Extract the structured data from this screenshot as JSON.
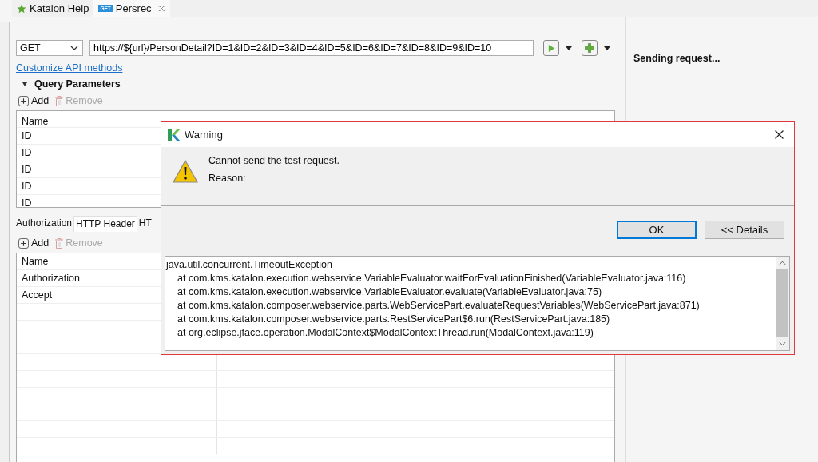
{
  "tabs": [
    {
      "kind": "help",
      "label": "Katalon Help",
      "selected": false
    },
    {
      "kind": "request",
      "label": "Persrec",
      "badge": "GET",
      "selected": true
    }
  ],
  "request": {
    "method": "GET",
    "url": "https://${url}/PersonDetail?ID=1&ID=2&ID=3&ID=4&ID=5&ID=6&ID=7&ID=8&ID=9&ID=10"
  },
  "customize_link": "Customize API methods",
  "query_section": {
    "title": "Query Parameters",
    "expanded": true,
    "add": "Add",
    "remove": "Remove",
    "remove_disabled": true,
    "column": "Name",
    "rows": [
      "ID",
      "ID",
      "ID",
      "ID",
      "ID"
    ]
  },
  "sub_tabs": [
    {
      "label": "Authorization",
      "selected": false
    },
    {
      "label": "HTTP Header",
      "selected": true
    },
    {
      "label": "HT",
      "selected": false
    }
  ],
  "headers_section": {
    "add": "Add",
    "remove": "Remove",
    "remove_disabled": true,
    "column": "Name",
    "rows": [
      "Authorization",
      "Accept"
    ]
  },
  "response": {
    "status": "Sending request..."
  },
  "dialog": {
    "title": "Warning",
    "message": "Cannot send the test request.",
    "reason_label": "Reason:",
    "buttons": [
      {
        "label": "OK",
        "default": true
      },
      {
        "label": "<< Details",
        "default": false
      }
    ],
    "details": [
      {
        "kind": "exception",
        "text": "java.util.concurrent.TimeoutException"
      },
      {
        "kind": "frame",
        "text": "at com.kms.katalon.execution.webservice.VariableEvaluator.waitForEvaluationFinished(VariableEvaluator.java:116)"
      },
      {
        "kind": "frame",
        "text": "at com.kms.katalon.execution.webservice.VariableEvaluator.evaluate(VariableEvaluator.java:75)"
      },
      {
        "kind": "frame",
        "text": "at com.kms.katalon.composer.webservice.parts.WebServicePart.evaluateRequestVariables(WebServicePart.java:871)"
      },
      {
        "kind": "frame",
        "text": "at com.kms.katalon.composer.webservice.parts.RestServicePart$6.run(RestServicePart.java:185)"
      },
      {
        "kind": "frame",
        "text": "at org.eclipse.jface.operation.ModalContext$ModalContextThread.run(ModalContext.java:119)"
      }
    ]
  }
}
